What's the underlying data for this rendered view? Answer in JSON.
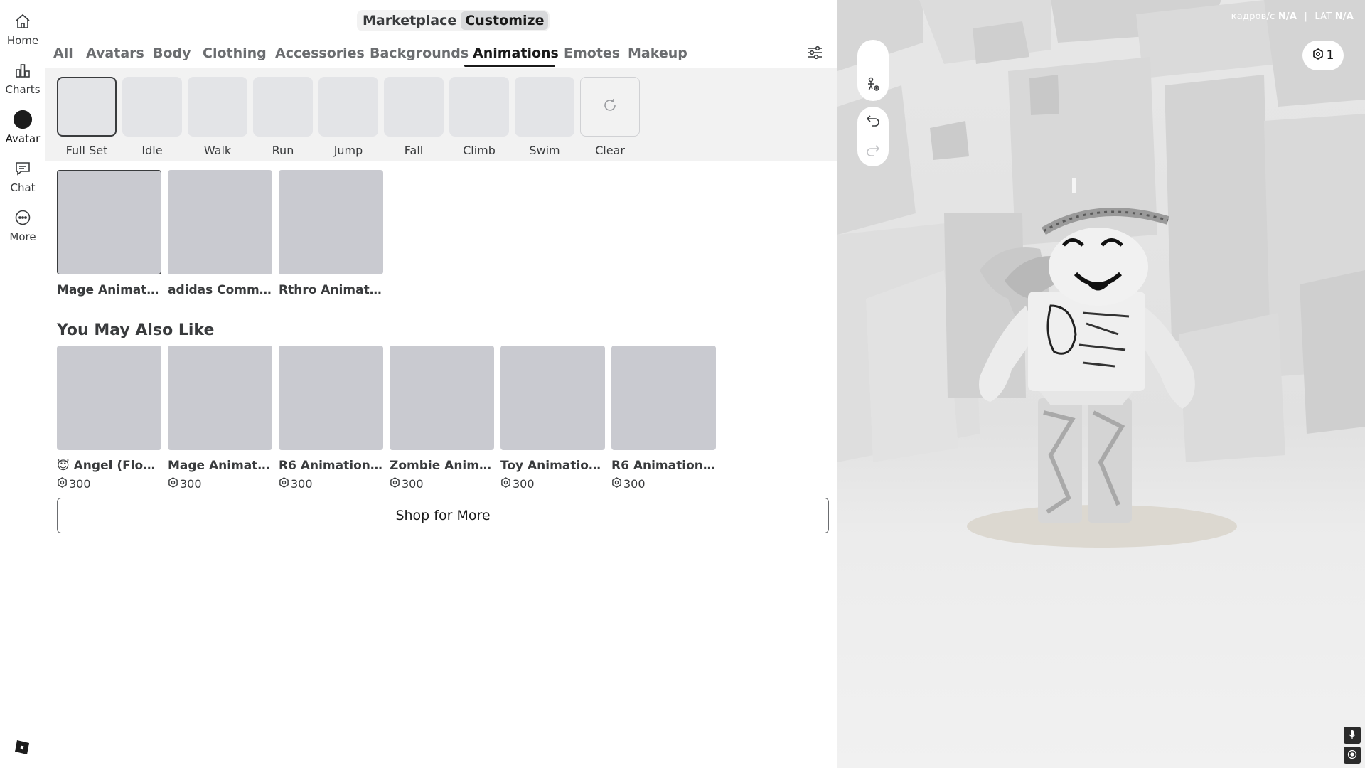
{
  "nav": {
    "items": [
      {
        "label": "Home",
        "icon": "home-icon"
      },
      {
        "label": "Charts",
        "icon": "charts-icon"
      },
      {
        "label": "Avatar",
        "icon": "avatar-icon"
      },
      {
        "label": "Chat",
        "icon": "chat-icon"
      },
      {
        "label": "More",
        "icon": "more-icon"
      }
    ],
    "active": "Avatar"
  },
  "mode": {
    "marketplace_label": "Marketplace",
    "customize_label": "Customize",
    "active": "Customize"
  },
  "tabs": {
    "items": [
      "All",
      "Avatars",
      "Body",
      "Clothing",
      "Accessories",
      "Backgrounds",
      "Animations",
      "Emotes",
      "Makeup"
    ],
    "active": "Animations"
  },
  "animation_slots": {
    "items": [
      "Full Set",
      "Idle",
      "Walk",
      "Run",
      "Jump",
      "Fall",
      "Climb",
      "Swim"
    ],
    "clear_label": "Clear",
    "active": "Full Set"
  },
  "owned": [
    {
      "name": "Mage Animatio..."
    },
    {
      "name": "adidas Commun..."
    },
    {
      "name": "Rthro Animatio..."
    }
  ],
  "recommended": {
    "title": "You May Also Like",
    "items": [
      {
        "name": "😇 Angel (Floati...",
        "price": "300"
      },
      {
        "name": "Mage Animatio...",
        "price": "300"
      },
      {
        "name": "R6 Animation P...",
        "price": "300"
      },
      {
        "name": "Zombie Animati...",
        "price": "300"
      },
      {
        "name": "Toy Animation ...",
        "price": "300"
      },
      {
        "name": "R6 Animation P...",
        "price": "300"
      }
    ]
  },
  "shop_button_label": "Shop for More",
  "viewport": {
    "stats": {
      "fps_label": "кадров/с",
      "fps_value": "N/A",
      "separator": "|",
      "lat_label": "LAT",
      "lat_value": "N/A"
    },
    "robux_count": "1"
  },
  "colors": {
    "selected_border": "#393b3d",
    "tile_bg": "#c9cad0",
    "slot_bg": "#e3e4e7",
    "subrow_bg": "#f2f2f2"
  }
}
